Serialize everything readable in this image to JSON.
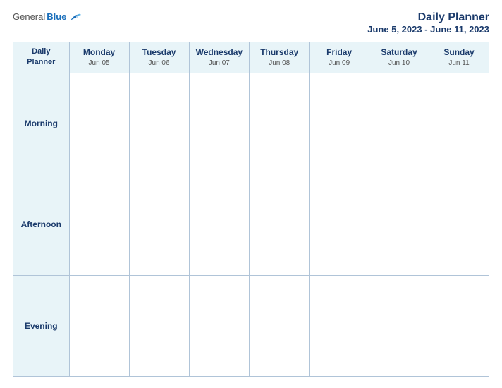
{
  "header": {
    "logo_general": "General",
    "logo_blue": "Blue",
    "title": "Daily Planner",
    "subtitle": "June 5, 2023 - June 11, 2023"
  },
  "table": {
    "header_label": "Daily\nPlanner",
    "days": [
      {
        "name": "Monday",
        "date": "Jun 05"
      },
      {
        "name": "Tuesday",
        "date": "Jun 06"
      },
      {
        "name": "Wednesday",
        "date": "Jun 07"
      },
      {
        "name": "Thursday",
        "date": "Jun 08"
      },
      {
        "name": "Friday",
        "date": "Jun 09"
      },
      {
        "name": "Saturday",
        "date": "Jun 10"
      },
      {
        "name": "Sunday",
        "date": "Jun 11"
      }
    ],
    "rows": [
      {
        "label": "Morning"
      },
      {
        "label": "Afternoon"
      },
      {
        "label": "Evening"
      }
    ]
  }
}
